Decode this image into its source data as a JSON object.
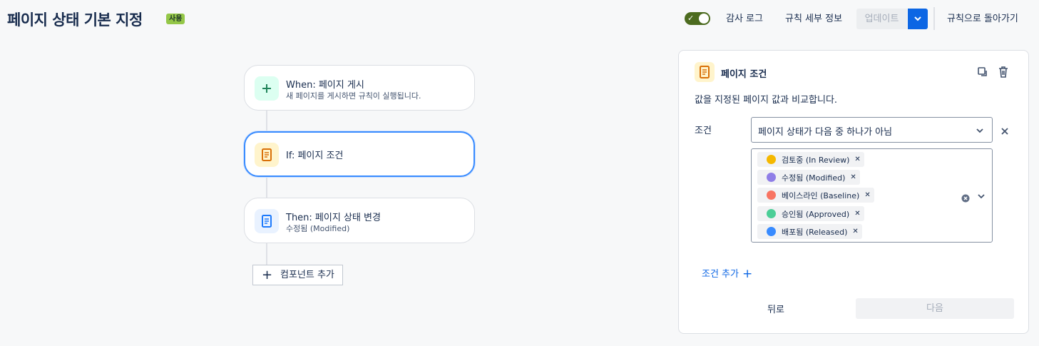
{
  "header": {
    "title": "페이지 상태 기본 지정",
    "status_badge": "사용",
    "audit_log": "감사 로그",
    "rule_details": "규칙 세부 정보",
    "update": "업데이트",
    "back_to_rules": "규칙으로 돌아가기",
    "toggle_enabled": true
  },
  "flow": {
    "trigger": {
      "title": "When: 페이지 게시",
      "subtitle": "새 페이지를 게시하면 규칙이 실행됩니다.",
      "icon": "plus-icon"
    },
    "condition": {
      "title": "If: 페이지 조건",
      "icon": "document-icon"
    },
    "action": {
      "title": "Then: 페이지 상태 변경",
      "subtitle": "수정됨 (Modified)",
      "icon": "document-icon"
    },
    "add_component": "컴포넌트 추가"
  },
  "panel": {
    "title": "페이지 조건",
    "description": "값을 지정된 페이지 값과 비교합니다.",
    "condition_label": "조건",
    "condition_value": "페이지 상태가 다음 중 하나가 아님",
    "statuses": [
      {
        "label": "검토중 (In Review)",
        "color": "#f5b800"
      },
      {
        "label": "수정됨 (Modified)",
        "color": "#8f7ee7"
      },
      {
        "label": "베이스라인 (Baseline)",
        "color": "#f87462"
      },
      {
        "label": "승인됨 (Approved)",
        "color": "#4bce97"
      },
      {
        "label": "배포됨 (Released)",
        "color": "#388bff"
      }
    ],
    "add_condition": "조건 추가",
    "back": "뒤로",
    "next": "다음"
  },
  "colors": {
    "accent": "#0c66e4",
    "selected_border": "#388bff",
    "badge": "#94c748",
    "toggle": "#4c6b1f"
  }
}
